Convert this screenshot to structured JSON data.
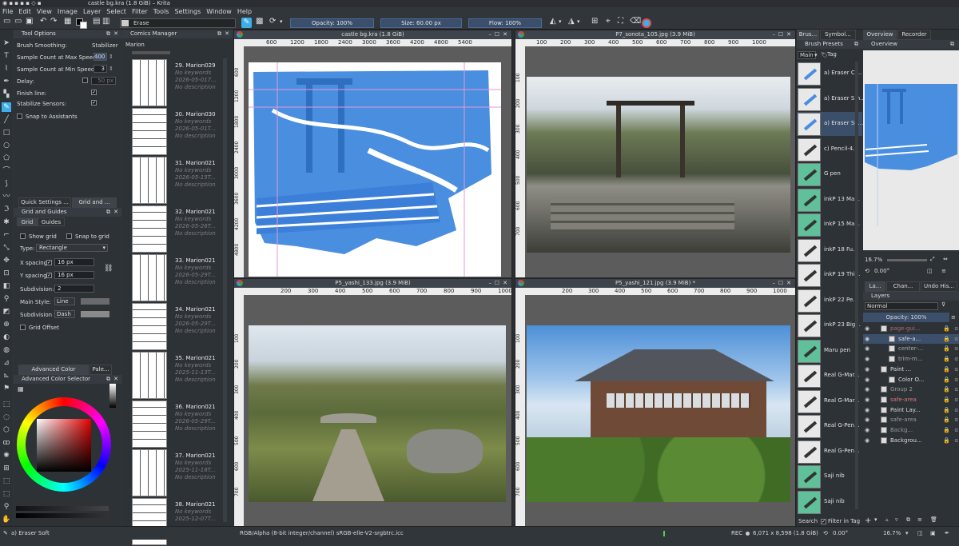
{
  "title": "castle bg.kra (1.8 GiB)  – Krita",
  "menu": [
    "File",
    "Edit",
    "View",
    "Image",
    "Layer",
    "Select",
    "Filter",
    "Tools",
    "Settings",
    "Window",
    "Help"
  ],
  "toolbar": {
    "preset": "Erase",
    "opacity": "Opacity: 100%",
    "size": "Size: 60.00 px",
    "flow": "Flow: 100%"
  },
  "tool_options": {
    "title": "Tool Options",
    "brush_smoothing": "Brush Smoothing:",
    "brush_smoothing_value": "Stabilizer",
    "max_speed_label": "Sample Count at Max Speed:",
    "max_speed_value": "400",
    "min_speed_label": "Sample Count at Min Speed:",
    "min_speed_value": "3",
    "delay_label": "Delay:",
    "delay_value": "50 px",
    "finish_line": "Finish line:",
    "stabilize_sensors": "Stabilize Sensors:",
    "snap_assistants": "Snap to Assistants"
  },
  "grid": {
    "tab_quick": "Quick Settings ...",
    "tab_grid": "Grid and ...",
    "title": "Grid and Guides",
    "tab1": "Grid",
    "tab2": "Guides",
    "show_grid": "Show grid",
    "snap_grid": "Snap to grid",
    "type_label": "Type:",
    "type_value": "Rectangle",
    "x_label": "X spacing:",
    "x_value": "16 px",
    "y_label": "Y spacing:",
    "y_value": "16 px",
    "subdiv_label": "Subdivision:",
    "subdiv_value": "2",
    "main_style_label": "Main Style:",
    "main_style_value": "Line",
    "subdiv_style_label": "Subdivision Style:",
    "subdiv_style_value": "Dash",
    "grid_offset": "Grid Offset"
  },
  "color": {
    "tab1": "Advanced Color Selecto...",
    "tab2": "Pale...",
    "title": "Advanced Color Selector"
  },
  "comics": {
    "title": "Comics Manager",
    "project": "Marion",
    "items": [
      {
        "name": "29. Marion029",
        "kw": "No keywords",
        "date": "2026-05-017...",
        "desc": "No description"
      },
      {
        "name": "30. Marion030",
        "kw": "No keywords",
        "date": "2026-05-01T...",
        "desc": "No description"
      },
      {
        "name": "31. Marion021",
        "kw": "No keywords",
        "date": "2026-05-15T...",
        "desc": "No description"
      },
      {
        "name": "32. Marion021",
        "kw": "No keywords",
        "date": "2026-05-26T...",
        "desc": "No description"
      },
      {
        "name": "33. Marion021",
        "kw": "No keywords",
        "date": "2026-05-29T...",
        "desc": "No description"
      },
      {
        "name": "34. Marion021",
        "kw": "No keywords",
        "date": "2026-05-29T...",
        "desc": "No description"
      },
      {
        "name": "35. Marion021",
        "kw": "No keywords",
        "date": "2025-11-13T...",
        "desc": "No description"
      },
      {
        "name": "36. Marion021",
        "kw": "No keywords",
        "date": "2026-05-29T...",
        "desc": "No description"
      },
      {
        "name": "37. Marion021",
        "kw": "No keywords",
        "date": "2025-11-18T...",
        "desc": "No description"
      },
      {
        "name": "38. Marion021",
        "kw": "No keywords",
        "date": "2025-12-07T...",
        "desc": ""
      }
    ]
  },
  "windows": {
    "w1": {
      "title": "castle bg.kra (1.8 GiB)",
      "hticks": [
        "600",
        "1200",
        "1800",
        "2400",
        "3000",
        "3600",
        "4200",
        "4800",
        "5400"
      ],
      "vticks": [
        "600",
        "1200",
        "1800",
        "2400",
        "3000",
        "3600",
        "4200",
        "4800"
      ]
    },
    "w2": {
      "title": "P7_sonota_105.jpg (3.9 MiB)",
      "hticks": [
        "100",
        "200",
        "300",
        "400",
        "500",
        "600",
        "700",
        "800",
        "900",
        "1000"
      ],
      "vticks": [
        "100",
        "200",
        "300",
        "400",
        "500",
        "600",
        "700"
      ]
    },
    "w3": {
      "title": "P5_yashi_133.jpg (3.9 MiB)",
      "hticks": [
        "200",
        "300",
        "400",
        "500",
        "600",
        "700",
        "800",
        "900",
        "1000"
      ],
      "vticks": [
        "100",
        "200",
        "300",
        "400",
        "500",
        "600",
        "700"
      ]
    },
    "w4": {
      "title": "P5_yashi_121.jpg (3.9 MiB) *",
      "hticks": [
        "200",
        "300",
        "400",
        "500",
        "600",
        "700",
        "800",
        "900",
        "1000"
      ],
      "vticks": [
        "100",
        "200",
        "300",
        "400",
        "500",
        "600",
        "700"
      ]
    }
  },
  "right": {
    "tab_brush": "Brus...",
    "tab_symbol": "Symbol...",
    "tab_overview": "Overview",
    "tab_recorder": "Recorder",
    "brush_presets": "Brush Presets",
    "overview": "Overview",
    "filter_main": "Main",
    "tag": "Tag",
    "search": "Search",
    "filter_in_tag": "Filter in Tag",
    "zoom": "16.7%",
    "rotation": "0.00°"
  },
  "brushes": [
    "a) Eraser Ci...",
    "a) Eraser Sm...",
    "a) Eraser So...",
    "c) Pencil-4...",
    "G pen",
    "inkP 13 Ma...",
    "inkP 15 Ma...",
    "inkP 18 Fu...",
    "inkP 19 Thi...",
    "inkP 22 Pe...",
    "inkP 23 Big...",
    "Maru pen",
    "Real G-Mar...",
    "Real G-Mar...",
    "Real G-Pen...",
    "Real G-Pen...",
    "Saji nib",
    "Saji nib"
  ],
  "layers_tabs": [
    "La...",
    "Chan...",
    "Undo His..."
  ],
  "layers": {
    "title": "Layers",
    "blend": "Normal",
    "opacity": "Opacity: 100%",
    "items": [
      {
        "name": "page-gui...",
        "indent": 0,
        "color": "#b06a6a"
      },
      {
        "name": "safe-a...",
        "indent": 1,
        "color": "#dcdcdc"
      },
      {
        "name": "center-...",
        "indent": 1,
        "color": "#aaaaaa"
      },
      {
        "name": "trim-m...",
        "indent": 1,
        "color": "#aaaaaa"
      },
      {
        "name": "Paint ...",
        "indent": 0,
        "color": "#dcdcdc"
      },
      {
        "name": "Color O...",
        "indent": 1,
        "color": "#dcdcdc"
      },
      {
        "name": "Group 2",
        "indent": 0,
        "color": "#999999"
      },
      {
        "name": "safe-area",
        "indent": 0,
        "color": "#d87878"
      },
      {
        "name": "Paint Lay...",
        "indent": 0,
        "color": "#dcdcdc"
      },
      {
        "name": "safe-area",
        "indent": 0,
        "color": "#999999"
      },
      {
        "name": "Backg...",
        "indent": 0,
        "color": "#999999"
      },
      {
        "name": "Backgrou...",
        "indent": 0,
        "color": "#dcdcdc"
      }
    ]
  },
  "status": {
    "brush": "a) Eraser Soft",
    "colorspace": "RGB/Alpha (8-bit integer/channel)  sRGB-elle-V2-srgbtrc.icc",
    "rec": "REC",
    "dims": "6,071 x 8,598 (1.8 GiB)",
    "rotation": "0.00°",
    "zoom": "16.7%"
  },
  "accent": "#3daee9"
}
